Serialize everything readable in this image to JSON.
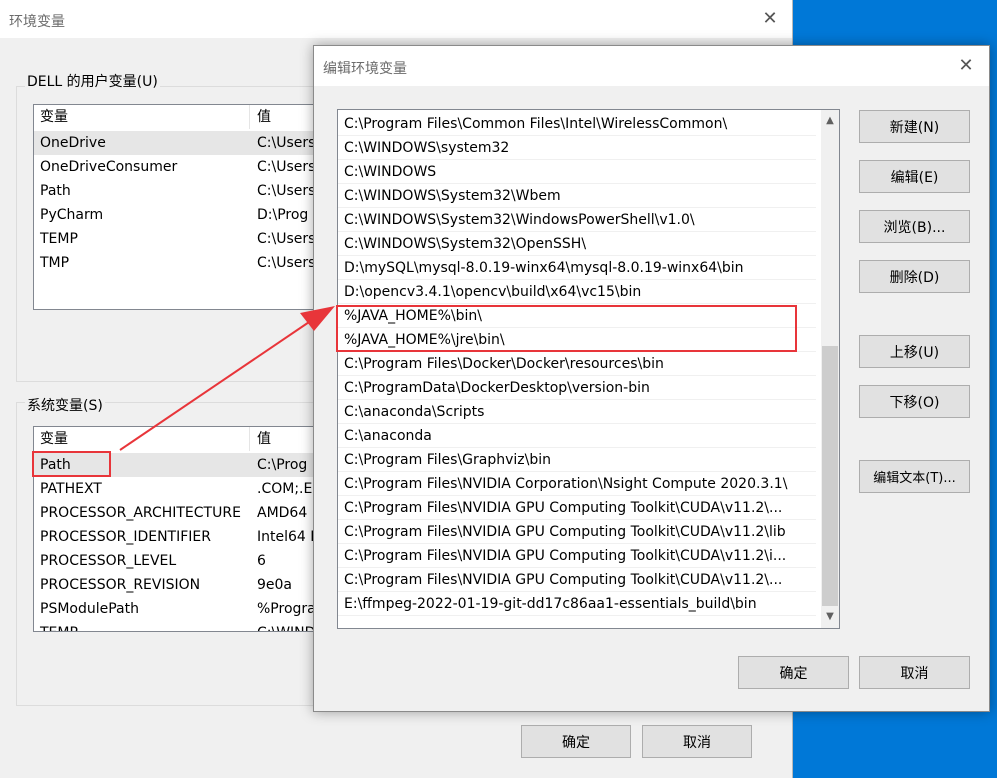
{
  "env_window": {
    "title": "环境变量",
    "user_group_label": "DELL 的用户变量(U)",
    "system_group_label": "系统变量(S)",
    "col_variable": "变量",
    "col_value": "值",
    "user_vars": [
      {
        "name": "OneDrive",
        "value": "C:\\Users"
      },
      {
        "name": "OneDriveConsumer",
        "value": "C:\\Users"
      },
      {
        "name": "Path",
        "value": "C:\\Users"
      },
      {
        "name": "PyCharm",
        "value": "D:\\Prog"
      },
      {
        "name": "TEMP",
        "value": "C:\\Users"
      },
      {
        "name": "TMP",
        "value": "C:\\Users"
      }
    ],
    "system_vars": [
      {
        "name": "Path",
        "value": "C:\\Prog"
      },
      {
        "name": "PATHEXT",
        "value": ".COM;.E"
      },
      {
        "name": "PROCESSOR_ARCHITECTURE",
        "value": "AMD64"
      },
      {
        "name": "PROCESSOR_IDENTIFIER",
        "value": "Intel64 F"
      },
      {
        "name": "PROCESSOR_LEVEL",
        "value": "6"
      },
      {
        "name": "PROCESSOR_REVISION",
        "value": "9e0a"
      },
      {
        "name": "PSModulePath",
        "value": "%Progra"
      },
      {
        "name": "TEMP",
        "value": "C:\\WIND"
      }
    ],
    "ok_label": "确定",
    "cancel_label": "取消"
  },
  "edit_window": {
    "title": "编辑环境变量",
    "paths": [
      "C:\\Program Files\\Common Files\\Intel\\WirelessCommon\\",
      "C:\\WINDOWS\\system32",
      "C:\\WINDOWS",
      "C:\\WINDOWS\\System32\\Wbem",
      "C:\\WINDOWS\\System32\\WindowsPowerShell\\v1.0\\",
      "C:\\WINDOWS\\System32\\OpenSSH\\",
      "D:\\mySQL\\mysql-8.0.19-winx64\\mysql-8.0.19-winx64\\bin",
      "D:\\opencv3.4.1\\opencv\\build\\x64\\vc15\\bin",
      "%JAVA_HOME%\\bin\\",
      "%JAVA_HOME%\\jre\\bin\\",
      "C:\\Program Files\\Docker\\Docker\\resources\\bin",
      "C:\\ProgramData\\DockerDesktop\\version-bin",
      "C:\\anaconda\\Scripts",
      "C:\\anaconda",
      "C:\\Program Files\\Graphviz\\bin",
      "C:\\Program Files\\NVIDIA Corporation\\Nsight Compute 2020.3.1\\",
      "C:\\Program Files\\NVIDIA GPU Computing Toolkit\\CUDA\\v11.2\\...",
      "C:\\Program Files\\NVIDIA GPU Computing Toolkit\\CUDA\\v11.2\\lib",
      "C:\\Program Files\\NVIDIA GPU Computing Toolkit\\CUDA\\v11.2\\i...",
      "C:\\Program Files\\NVIDIA GPU Computing Toolkit\\CUDA\\v11.2\\...",
      "E:\\ffmpeg-2022-01-19-git-dd17c86aa1-essentials_build\\bin"
    ],
    "buttons": {
      "new": "新建(N)",
      "edit": "编辑(E)",
      "browse": "浏览(B)...",
      "delete": "删除(D)",
      "move_up": "上移(U)",
      "move_down": "下移(O)",
      "edit_text": "编辑文本(T)..."
    },
    "ok_label": "确定",
    "cancel_label": "取消"
  },
  "colors": {
    "highlight_red": "#e8353a",
    "desktop_blue": "#0078d7"
  },
  "icons": {
    "close": "close-icon",
    "scroll_up": "chevron-up-icon",
    "scroll_down": "chevron-down-icon"
  }
}
